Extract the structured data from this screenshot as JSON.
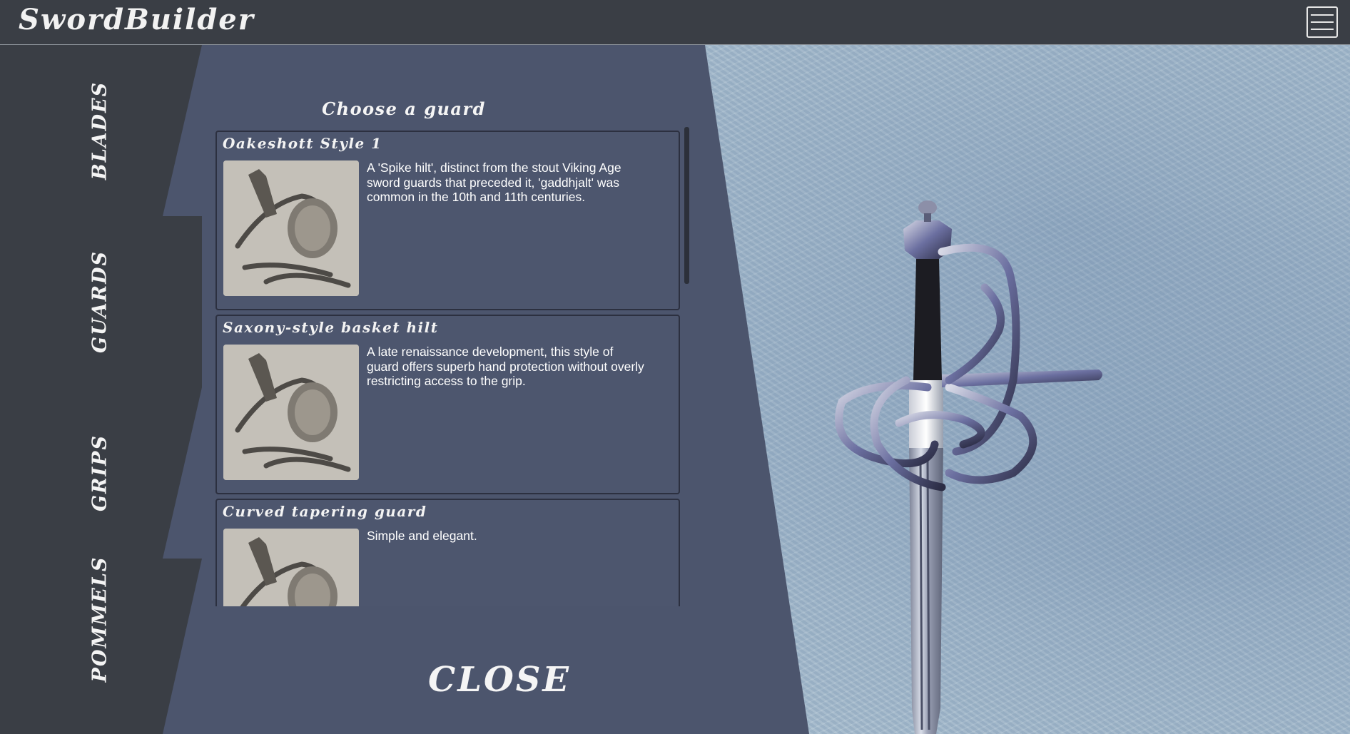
{
  "app": {
    "title": "SwordBuilder"
  },
  "menu": {
    "icon": "hamburger-menu-icon"
  },
  "tabs": [
    {
      "label": "BLADES"
    },
    {
      "label": "GUARDS"
    },
    {
      "label": "GRIPS"
    },
    {
      "label": "POMMELS"
    }
  ],
  "panel": {
    "title": "Choose a guard",
    "close_label": "CLOSE",
    "cards": [
      {
        "name": "Oakeshott Style 1",
        "description": "A 'Spike hilt', distinct from the stout Viking Age sword guards that preceded it, 'gaddhjalt' was common in the 10th and 11th centuries.",
        "thumbnail": "guard-thumbnail-image"
      },
      {
        "name": "Saxony-style basket hilt",
        "description": "A late renaissance development, this style of guard offers superb hand protection without overly restricting access to the grip.",
        "thumbnail": "guard-thumbnail-image"
      },
      {
        "name": "Curved tapering guard",
        "description": "Simple and elegant.",
        "thumbnail": "guard-thumbnail-image"
      }
    ]
  },
  "colors": {
    "topbar": "#3a3e45",
    "panel": "#4c556d",
    "tab": "#3a3e45",
    "viewer": "#b4c8d5"
  }
}
